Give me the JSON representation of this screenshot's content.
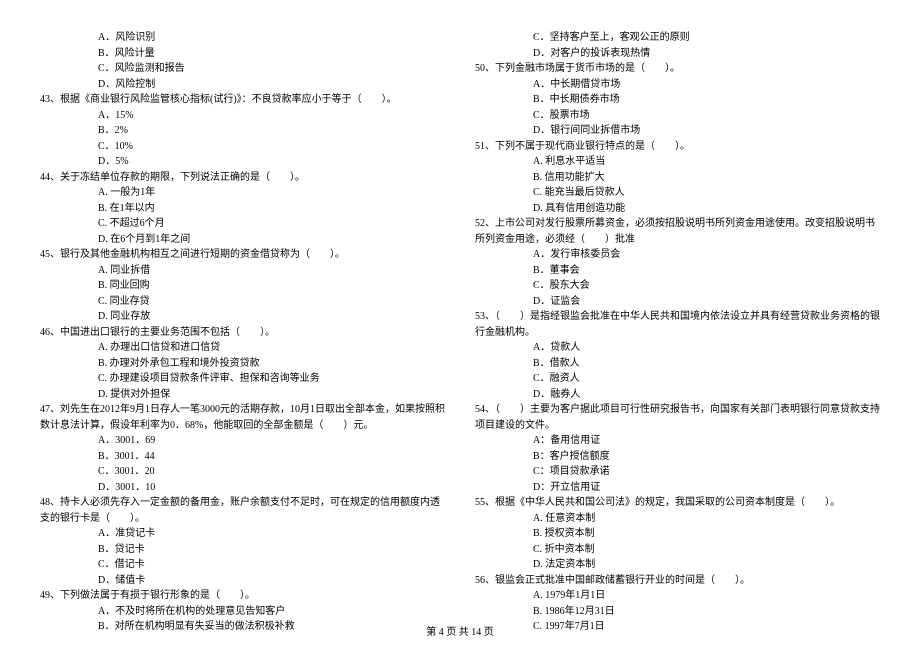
{
  "left": {
    "pre_opts": [
      "A．风险识别",
      "B．风险计量",
      "C．风险监测和报告",
      "D．风险控制"
    ],
    "q43": "43、根据《商业银行风险监管核心指标(试行)》：不良贷款率应小于等于（　　）。",
    "q43_opts": [
      "A．15%",
      "B．2%",
      "C．10%",
      "D．5%"
    ],
    "q44": "44、关于冻结单位存款的期限，下列说法正确的是（　　）。",
    "q44_opts": [
      "A. 一般为1年",
      "B. 在1年以内",
      "C. 不超过6个月",
      "D. 在6个月到1年之间"
    ],
    "q45": "45、银行及其他金融机构相互之间进行短期的资金借贷称为（　　）。",
    "q45_opts": [
      "A. 同业拆借",
      "B. 同业回购",
      "C. 同业存贷",
      "D. 同业存放"
    ],
    "q46": "46、中国进出口银行的主要业务范围不包括（　　）。",
    "q46_opts": [
      "A. 办理出口信贷和进口信贷",
      "B. 办理对外承包工程和境外投资贷款",
      "C. 办理建设项目贷款条件评审、担保和咨询等业务",
      "D. 提供对外担保"
    ],
    "q47": "47、刘先生在2012年9月1日存人一笔3000元的活期存款，10月1日取出全部本金，如果按照积数计息法计算，假设年利率为0．68%，他能取回的全部金额是（　　）元。",
    "q47_opts": [
      "A．3001．69",
      "B．3001．44",
      "C．3001．20",
      "D．3001．10"
    ],
    "q48": "48、持卡人必须先存入一定金额的备用金，账户余额支付不足时，可在规定的信用额度内透支的银行卡是（　　）。",
    "q48_opts": [
      "A．准贷记卡",
      "B．贷记卡",
      "C．借记卡",
      "D．储值卡"
    ],
    "q49": "49、下列做法属于有损于银行形象的是（　　）。",
    "q49_opts": [
      "A．不及时将所在机构的处理意见告知客户",
      "B．对所在机构明显有失妥当的做法积极补救"
    ]
  },
  "right": {
    "pre_opts": [
      "C．坚持客户至上，客观公正的原则",
      "D．对客户的投诉表现热情"
    ],
    "q50": "50、下列金融市场属于货币市场的是（　　）。",
    "q50_opts": [
      "A．中长期借贷市场",
      "B．中长期债券市场",
      "C．股票市场",
      "D．银行间同业拆借市场"
    ],
    "q51": "51、下列不属于现代商业银行特点的是（　　）。",
    "q51_opts": [
      "A. 利息水平适当",
      "B. 信用功能扩大",
      "C. 能充当最后贷款人",
      "D. 具有信用创造功能"
    ],
    "q52": "52、上市公司对发行股票所募资金，必须按招股说明书所列资金用途使用。改变招股说明书所列资金用途，必须经（　　）批准",
    "q52_opts": [
      "A．发行审核委员会",
      "B．董事会",
      "C．股东大会",
      "D．证监会"
    ],
    "q53": "53、（　　）是指经银监会批准在中华人民共和国境内依法设立并具有经营贷款业务资格的银行金融机构。",
    "q53_opts": [
      "A．贷款人",
      "B．借款人",
      "C．融资人",
      "D．融券人"
    ],
    "q54": "54、（　　）主要为客户据此项目可行性研究报告书，向国家有关部门表明银行同意贷款支持项目建设的文件。",
    "q54_opts": [
      "A：备用信用证",
      "B：客户授信额度",
      "C：项目贷款承诺",
      "D：开立信用证"
    ],
    "q55": "55、根据《中华人民共和国公司法》的规定，我国采取的公司资本制度是（　　）。",
    "q55_opts": [
      "A. 任意资本制",
      "B. 授权资本制",
      "C. 折中资本制",
      "D. 法定资本制"
    ],
    "q56": "56、银监会正式批准中国邮政储蓄银行开业的时间是（　　）。",
    "q56_opts": [
      "A. 1979年1月1日",
      "B. 1986年12月31日",
      "C. 1997年7月1日"
    ]
  },
  "footer": "第 4 页 共 14 页"
}
